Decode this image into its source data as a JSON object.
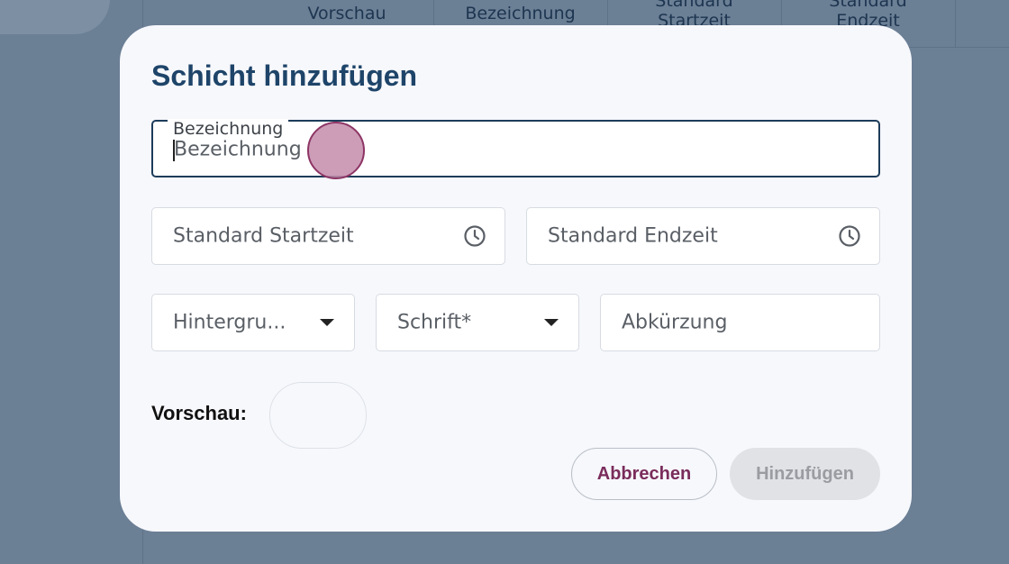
{
  "background": {
    "columns": [
      {
        "line1": "Vorschau",
        "line2": ""
      },
      {
        "line1": "Bezeichnung",
        "line2": ""
      },
      {
        "line1": "Standard",
        "line2": "Startzeit"
      },
      {
        "line1": "Standard",
        "line2": "Endzeit"
      }
    ]
  },
  "dialog": {
    "title": "Schicht hinzufügen",
    "name_field": {
      "label": "Bezeichnung",
      "placeholder": "Bezeichnung",
      "value": ""
    },
    "start_time_field": {
      "placeholder": "Standard Startzeit",
      "icon": "clock-icon"
    },
    "end_time_field": {
      "placeholder": "Standard Endzeit",
      "icon": "clock-icon"
    },
    "background_select": {
      "placeholder": "Hintergru..."
    },
    "font_select": {
      "placeholder": "Schrift*"
    },
    "abbreviation_field": {
      "placeholder": "Abkürzung"
    },
    "preview_label": "Vorschau:",
    "cancel_label": "Abbrechen",
    "add_label": "Hinzufügen"
  },
  "colors": {
    "overlay": "#6b7f95",
    "title": "#1e4469",
    "cancel_text": "#7a2c5b",
    "disabled_button": "#e1e2e6"
  }
}
